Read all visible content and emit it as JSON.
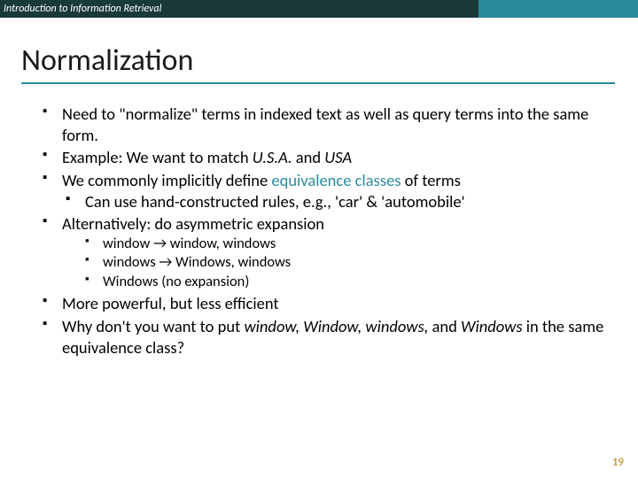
{
  "header": {
    "course": "Introduction to Information Retrieval"
  },
  "title": "Normalization",
  "bullets": {
    "b0": "Need to \"normalize\" terms in indexed text as well as query terms into the same form.",
    "b1_a": "Example: We want to match ",
    "b1_i1": "U.S.A.",
    "b1_mid": " and ",
    "b1_i2": "USA",
    "b2_a": "We commonly implicitly define ",
    "b2_teal": "equivalence classes",
    "b2_b": " of terms",
    "b2_sub": "Can use hand-constructed rules, e.g., 'car' & 'automobile'",
    "b3": "Alternatively: do asymmetric expansion",
    "b3_s1": "window → window, windows",
    "b3_s2": "windows → Windows, windows",
    "b3_s3": "Windows (no expansion)",
    "b4": "More powerful, but less efficient",
    "b5_a": "Why don't you want to put ",
    "b5_i1": "window, Window, windows,",
    "b5_mid": " and ",
    "b5_i2": "Windows",
    "b5_b": " in the same equivalence class?"
  },
  "page": "19"
}
